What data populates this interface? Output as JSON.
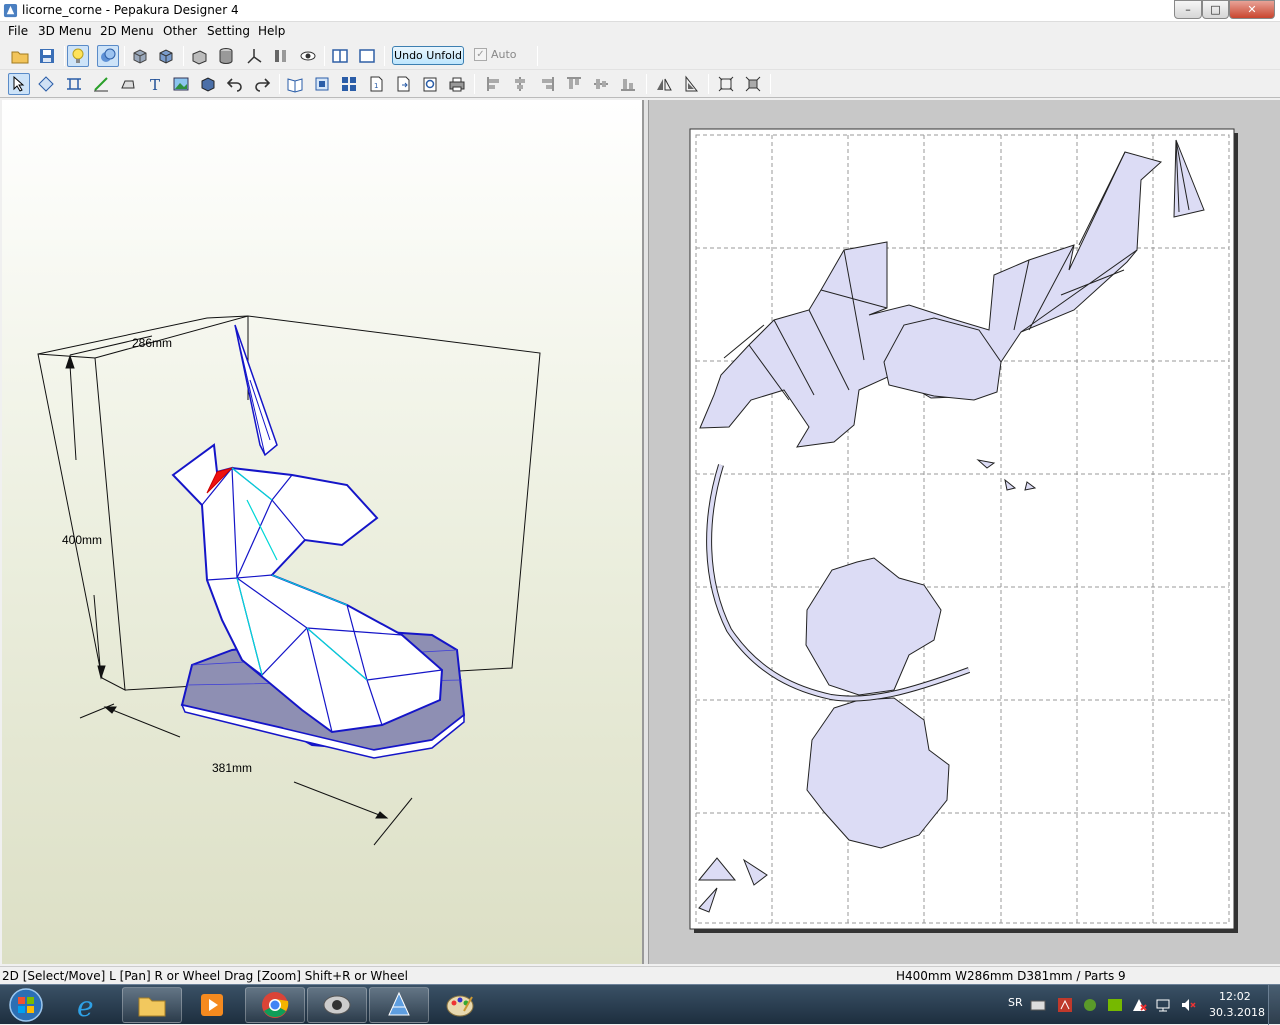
{
  "window": {
    "title": "licorne_corne - Pepakura Designer 4",
    "minimize_glyph": "–",
    "maximize_glyph": "□",
    "close_glyph": "✕"
  },
  "menu": [
    "File",
    "3D Menu",
    "2D Menu",
    "Other",
    "Setting",
    "Help"
  ],
  "toolbar": {
    "undo_unfold_label": "Undo Unfold",
    "auto_label": "Auto",
    "auto_checked": true,
    "auto_enabled": false
  },
  "view3d": {
    "dim_depth": "286mm",
    "dim_height": "400mm",
    "dim_width": "381mm",
    "model_fill": "#ffffff",
    "model_edge": "#1515c8",
    "fold_line": "#00d6d6",
    "base_fill": "#8e8fb3"
  },
  "view2d": {
    "paper_fill": "#ffffff",
    "part_fill": "#dcdcf5",
    "grid_color": "#999999"
  },
  "status": {
    "left": "2D [Select/Move] L [Pan] R or Wheel Drag [Zoom] Shift+R or Wheel",
    "right": "H400mm W286mm D381mm / Parts 9"
  },
  "taskbar": {
    "apps": [
      "Internet Explorer",
      "Windows Explorer",
      "Windows Media Player",
      "Google Chrome",
      "Pepakura Viewer",
      "Pepakura Designer",
      "Paint"
    ],
    "language": "SR",
    "time": "12:02",
    "date": "30.3.2018"
  }
}
